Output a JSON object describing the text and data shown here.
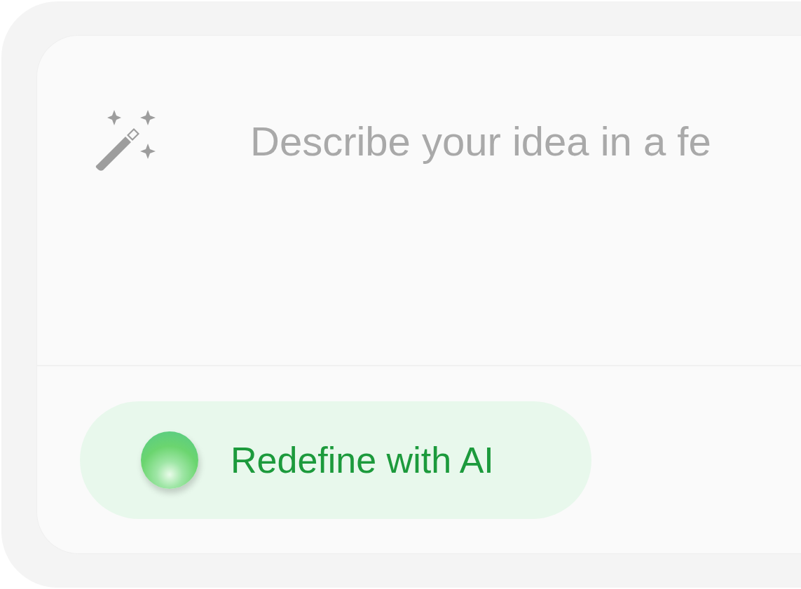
{
  "prompt": {
    "placeholder": "Describe your idea in a fe"
  },
  "action_button": {
    "label": "Redefine with AI"
  }
}
